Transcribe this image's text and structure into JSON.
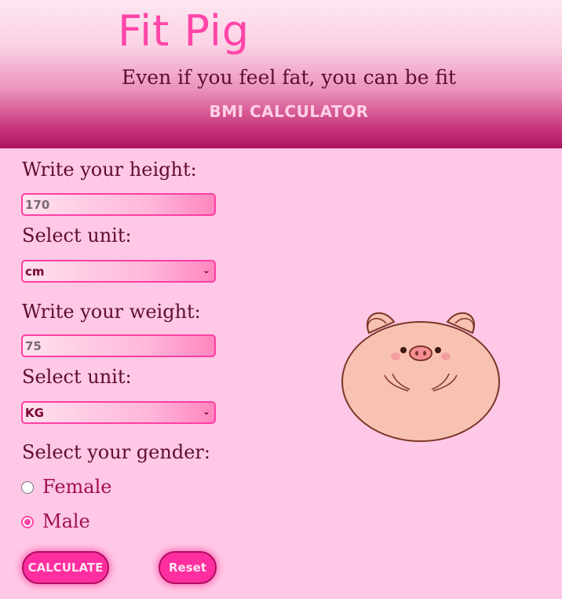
{
  "header": {
    "title": "Fit Pig",
    "subtitle": "Even if you feel fat, you can be fit",
    "section_title": "BMI CALCULATOR"
  },
  "form": {
    "height_label": "Write your height:",
    "height_value": "170",
    "height_unit_label": "Select unit:",
    "height_unit_selected": "cm",
    "weight_label": "Write your weight:",
    "weight_value": "75",
    "weight_unit_label": "Select unit:",
    "weight_unit_selected": "KG",
    "gender_label": "Select your gender:",
    "gender_options": [
      {
        "label": "Female",
        "checked": false
      },
      {
        "label": "Male",
        "checked": true
      }
    ]
  },
  "buttons": {
    "calculate": "CALCULATE",
    "reset": "Reset"
  },
  "icons": {
    "dropdown": "chevron-down-icon",
    "illustration": "pig-icon"
  },
  "colors": {
    "background": "#ffc8e6",
    "accent": "#ff2ea0",
    "title": "#ff45a8",
    "header_dark": "#b01262"
  }
}
